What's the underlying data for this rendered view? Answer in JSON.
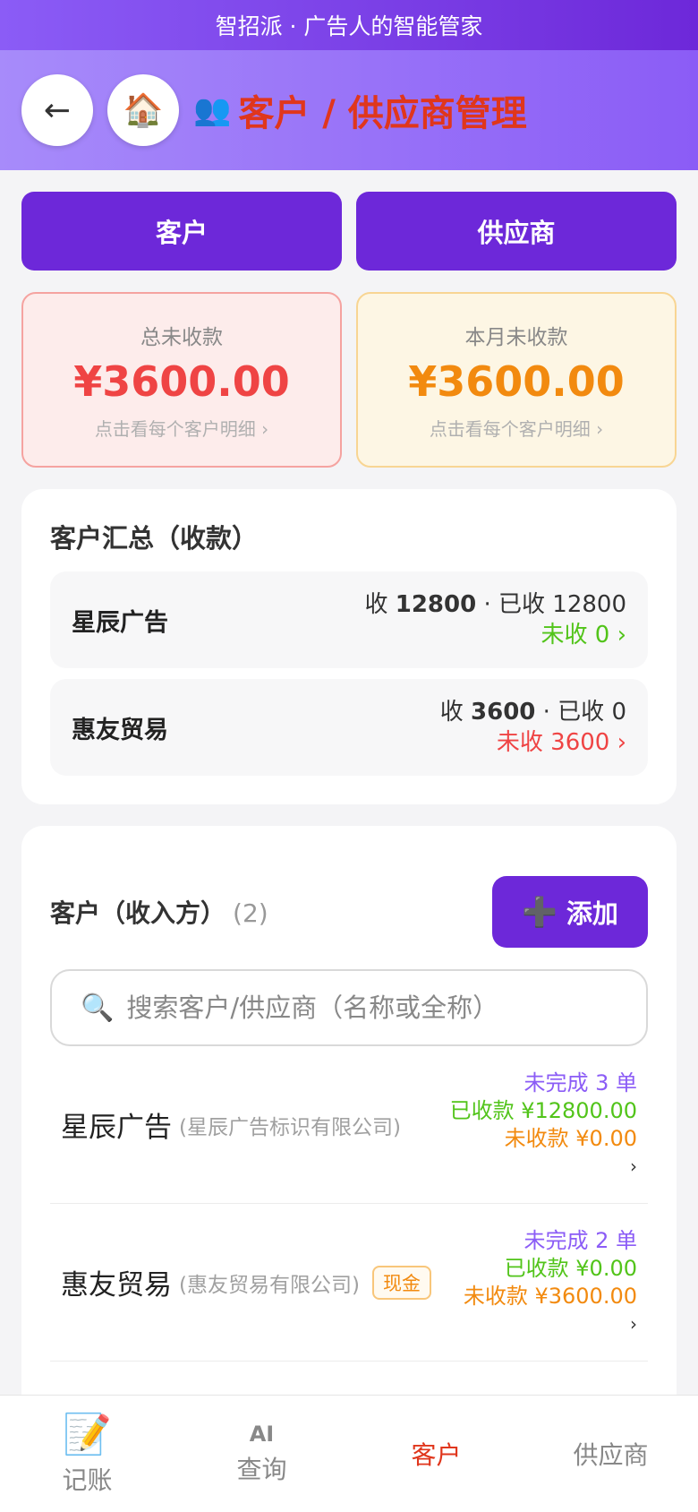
{
  "banner": "智招派 · 广告人的智能管家",
  "header": {
    "back_icon": "←",
    "home_icon": "🏠",
    "people_icon": "👥",
    "title": "客户 / 供应商管理"
  },
  "toggle": {
    "customer": "客户",
    "supplier": "供应商"
  },
  "summary": {
    "total": {
      "label": "总未收款",
      "amount": "¥3600.00",
      "hint": "点击看每个客户明细 ›"
    },
    "month": {
      "label": "本月未收款",
      "amount": "¥3600.00",
      "hint": "点击看每个客户明细 ›"
    }
  },
  "customer_summary": {
    "title": "客户汇总（收款）",
    "items": [
      {
        "name": "星辰广告",
        "receivable_label": "收",
        "receivable": "12800",
        "received_label": "· 已收 12800",
        "unpaid": "未收 0 ›"
      },
      {
        "name": "惠友贸易",
        "receivable_label": "收",
        "receivable": "3600",
        "received_label": "· 已收 0",
        "unpaid": "未收 3600 ›"
      }
    ]
  },
  "customer_list": {
    "title": "客户（收入方）",
    "count": "(2)",
    "add_icon": "➕",
    "add_label": "添加",
    "search_icon": "🔍",
    "search_placeholder": "搜索客户/供应商（名称或全称）",
    "rows": [
      {
        "name": "星辰广告",
        "full_name": "(星辰广告标识有限公司)",
        "badge": "",
        "pending": "未完成 3 单",
        "received": "已收款 ¥12800.00",
        "unpaid": "未收款 ¥0.00",
        "arrow": "›"
      },
      {
        "name": "惠友贸易",
        "full_name": "(惠友贸易有限公司)",
        "badge": "现金",
        "pending": "未完成 2 单",
        "received": "已收款 ¥0.00",
        "unpaid": "未收款 ¥3600.00",
        "arrow": "›"
      }
    ]
  },
  "bottom_nav": {
    "items": [
      {
        "icon": "📝",
        "label": "记账"
      },
      {
        "icon": "AI",
        "label": "查询"
      },
      {
        "label": "客户"
      },
      {
        "label": "供应商"
      }
    ]
  },
  "colors": {
    "primary": "#6d28d9",
    "title_red": "#e0361c",
    "amount_red": "#ef4444",
    "amount_orange": "#f28a0f",
    "green": "#52c41a",
    "purple": "#8b5cf6"
  }
}
